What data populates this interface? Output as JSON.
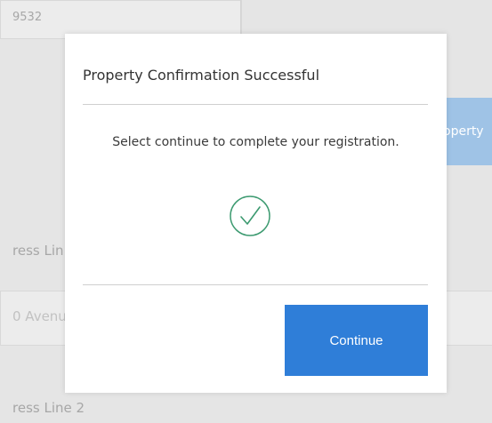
{
  "background": {
    "top_field_value": "9532",
    "side_button_label": "operty",
    "address_line_label": "ress Lin",
    "address_value": "0 Avenu",
    "address_line2_label": "ress Line 2"
  },
  "modal": {
    "title": "Property Confirmation Successful",
    "message": "Select continue to complete your registration.",
    "status_icon": "check-circle-icon",
    "continue_label": "Continue"
  },
  "colors": {
    "accent": "#2f7ed8",
    "success": "#3c9a70",
    "overlay": "#e5e5e5"
  }
}
